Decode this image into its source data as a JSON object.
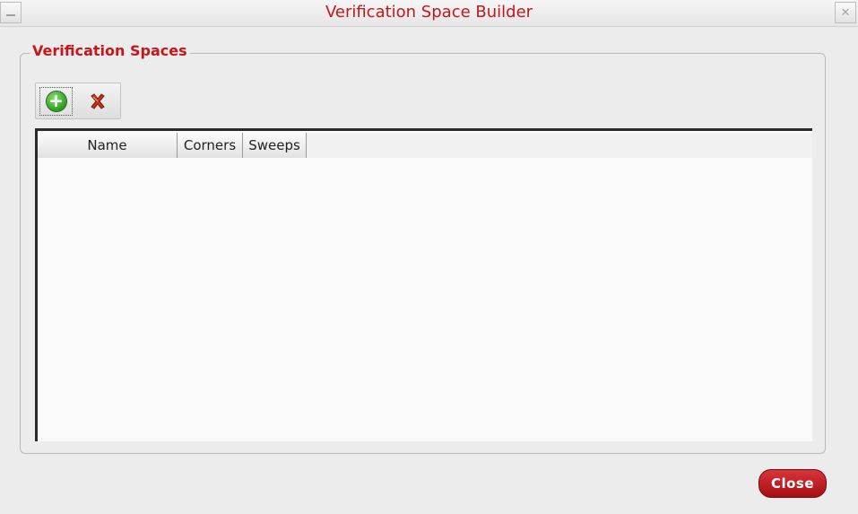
{
  "window": {
    "title": "Verification Space Builder",
    "minimize_icon": "minimize-icon",
    "close_icon": "close-x-icon"
  },
  "group": {
    "legend": "Verification Spaces"
  },
  "toolbar": {
    "add_icon": "add-green-plus-icon",
    "delete_icon": "delete-red-x-icon"
  },
  "table": {
    "columns": [
      "Name",
      "Corners",
      "Sweeps"
    ],
    "rows": []
  },
  "footer": {
    "close_label": "Close"
  },
  "colors": {
    "accent": "#c8151b",
    "close_button": "#c0191e",
    "add_icon": "#2c9a1e"
  }
}
